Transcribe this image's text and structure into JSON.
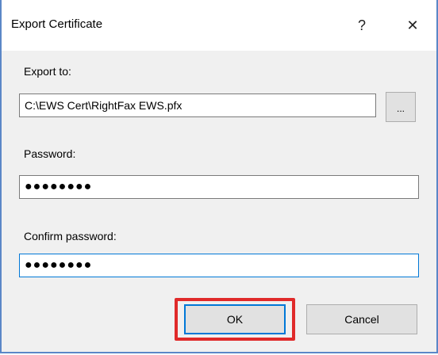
{
  "dialog": {
    "title": "Export Certificate",
    "help_glyph": "?",
    "close_glyph": "✕"
  },
  "export_to": {
    "label": "Export to:",
    "value": "C:\\EWS Cert\\RightFax EWS.pfx",
    "browse_label": "..."
  },
  "password": {
    "label": "Password:",
    "masked_value": "●●●●●●●●"
  },
  "confirm_password": {
    "label": "Confirm password:",
    "masked_value": "●●●●●●●●"
  },
  "buttons": {
    "ok_label": "OK",
    "cancel_label": "Cancel"
  },
  "colors": {
    "window_border": "#5b87c7",
    "focus_blue": "#0078d7",
    "highlight_red": "#e02a2a"
  }
}
